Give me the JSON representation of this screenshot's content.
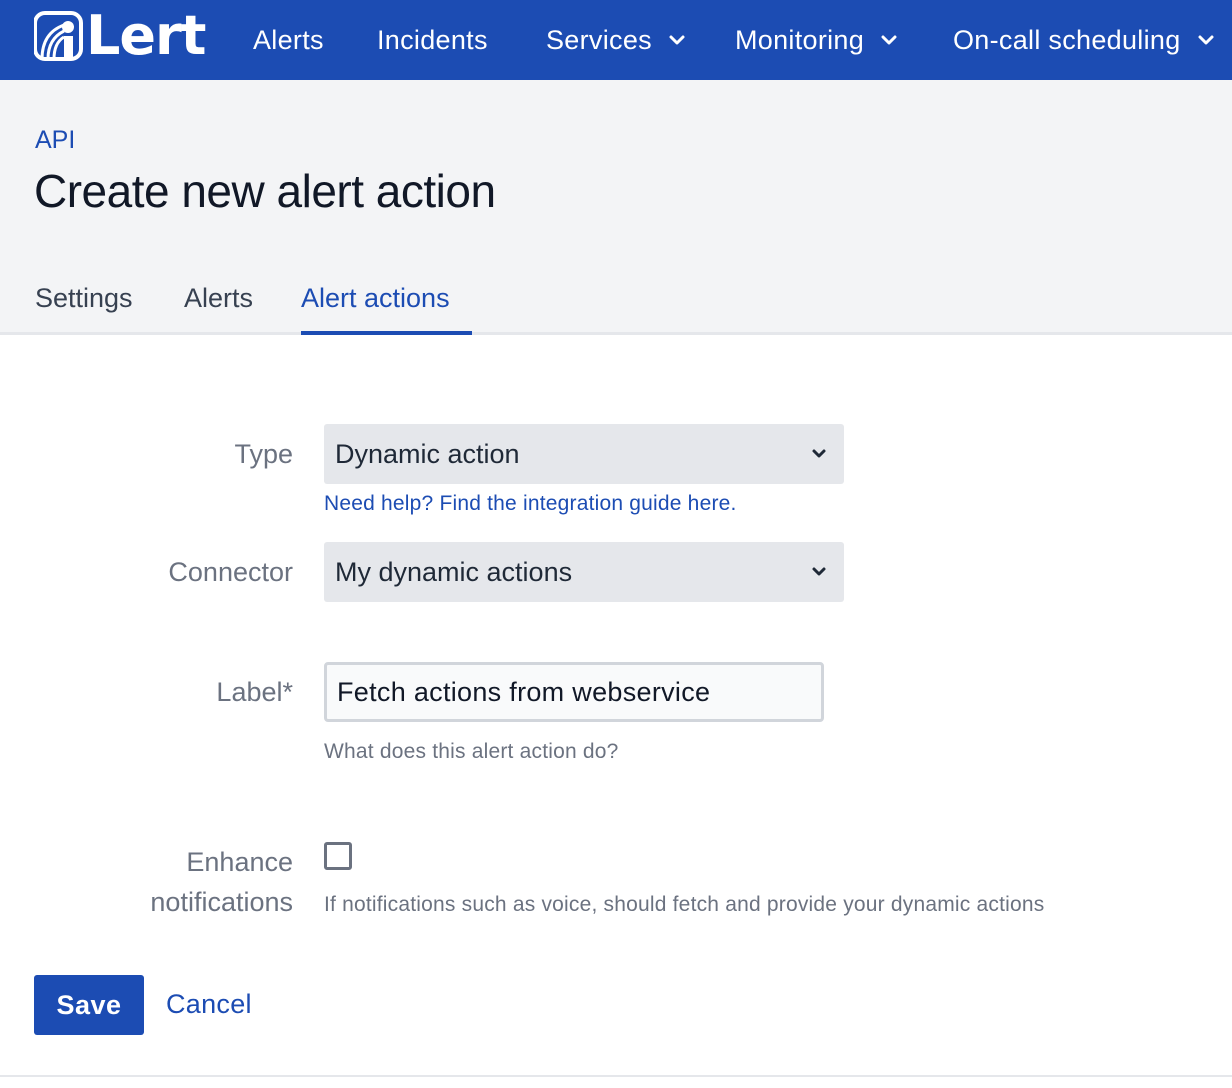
{
  "brand": {
    "logo_text": "Lert",
    "nav_color": "#1c4cb3"
  },
  "nav": {
    "items": [
      {
        "label": "Alerts"
      },
      {
        "label": "Incidents"
      },
      {
        "label": "Services"
      },
      {
        "label": "Monitoring"
      },
      {
        "label": "On-call scheduling"
      }
    ]
  },
  "header": {
    "breadcrumb": "API",
    "title": "Create new alert action"
  },
  "tabs": [
    {
      "label": "Settings"
    },
    {
      "label": "Alerts"
    },
    {
      "label": "Alert actions",
      "active": true
    }
  ],
  "form": {
    "type": {
      "label": "Type",
      "value": "Dynamic action",
      "help_link": "Need help? Find the integration guide here."
    },
    "connector": {
      "label": "Connector",
      "value": "My dynamic actions"
    },
    "label_field": {
      "label": "Label*",
      "value": "Fetch actions from webservice",
      "hint": "What does this alert action do?"
    },
    "enhance": {
      "label_line1": "Enhance",
      "label_line2": "notifications",
      "checked": false,
      "hint": "If notifications such as voice, should fetch and provide your dynamic actions"
    }
  },
  "actions": {
    "save_label": "Save",
    "cancel_label": "Cancel"
  }
}
